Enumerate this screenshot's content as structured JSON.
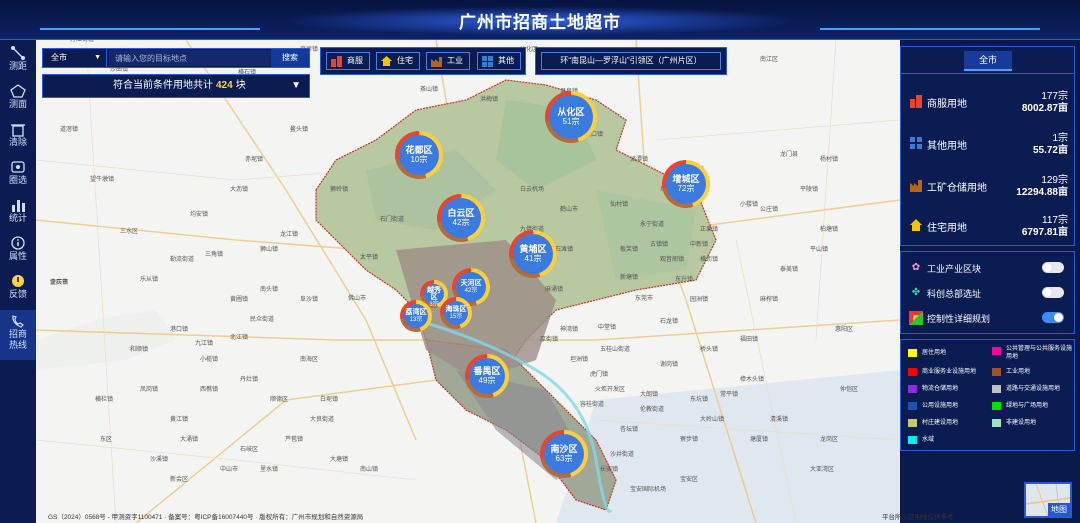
{
  "header": {
    "title": "广州市招商土地超市"
  },
  "sidebar": {
    "items": [
      {
        "label": "测距",
        "icon": "ruler-icon"
      },
      {
        "label": "测面",
        "icon": "polygon-icon"
      },
      {
        "label": "清除",
        "icon": "trash-icon"
      },
      {
        "label": "圈选",
        "icon": "lasso-icon"
      },
      {
        "label": "统计",
        "icon": "bar-chart-icon"
      },
      {
        "label": "属性",
        "icon": "info-icon"
      },
      {
        "label": "反馈",
        "icon": "feedback-icon"
      },
      {
        "label": "招商\n热线",
        "icon": "phone-icon"
      }
    ]
  },
  "search": {
    "city": "全市",
    "placeholder": "请输入您的目标地点",
    "button": "搜索"
  },
  "result": {
    "prefix": "符合当前条件用地共计",
    "count": "424",
    "suffix": "块"
  },
  "categories": [
    {
      "label": "商服",
      "icon": "shop-icon",
      "color": "#e8452e"
    },
    {
      "label": "住宅",
      "icon": "house-icon",
      "color": "#f5c400"
    },
    {
      "label": "工业",
      "icon": "factory-icon",
      "color": "#b5651d"
    },
    {
      "label": "其他",
      "icon": "grid-icon",
      "color": "#3a7bd5"
    }
  ],
  "ring_zone": {
    "label": "环“南昆山—罗浮山”引领区（广州片区）"
  },
  "stats_panel": {
    "tab": "全市",
    "items": [
      {
        "label": "商服用地",
        "count": "177宗",
        "area": "8002.87亩",
        "icon": "shop-icon",
        "color": "#e8452e"
      },
      {
        "label": "其他用地",
        "count": "1宗",
        "area": "55.72亩",
        "icon": "grid-icon",
        "color": "#3a7bd5"
      },
      {
        "label": "工矿仓储用地",
        "count": "129宗",
        "area": "12294.88亩",
        "icon": "factory-icon",
        "color": "#b5651d"
      },
      {
        "label": "住宅用地",
        "count": "117宗",
        "area": "6797.81亩",
        "icon": "house-icon",
        "color": "#f5c400"
      }
    ]
  },
  "layers": [
    {
      "label": "工业产业区块",
      "on": false,
      "icon": "industry-block-icon"
    },
    {
      "label": "科创总部选址",
      "on": false,
      "icon": "hq-site-icon"
    },
    {
      "label": "控制性详细规划",
      "on": true,
      "icon": "zoning-plan-icon"
    }
  ],
  "legend": [
    {
      "label": "居住用地",
      "color": "#ffff00"
    },
    {
      "label": "公共管理与公共服务设施用地",
      "color": "#ff00a0"
    },
    {
      "label": "商业服务业设施用地",
      "color": "#ff0000"
    },
    {
      "label": "工业用地",
      "color": "#a0522d"
    },
    {
      "label": "物流仓储用地",
      "color": "#8a2be2"
    },
    {
      "label": "道路与交通设施用地",
      "color": "#c0c0c0"
    },
    {
      "label": "公用设施用地",
      "color": "#1e50b4"
    },
    {
      "label": "绿地与广场用地",
      "color": "#00e000"
    },
    {
      "label": "村庄建设用地",
      "color": "#c8c864"
    },
    {
      "label": "非建设用地",
      "color": "#9fe2bf"
    },
    {
      "label": "水域",
      "color": "#00f0f0"
    }
  ],
  "districts": [
    {
      "name": "从化区",
      "count": "51宗"
    },
    {
      "name": "花都区",
      "count": "10宗"
    },
    {
      "name": "增城区",
      "count": "72宗"
    },
    {
      "name": "白云区",
      "count": "42宗"
    },
    {
      "name": "黄埔区",
      "count": "41宗"
    },
    {
      "name": "天河区",
      "count": "42宗"
    },
    {
      "name": "越秀区",
      "count": "3宗"
    },
    {
      "name": "荔湾区",
      "count": "13宗"
    },
    {
      "name": "海珠区",
      "count": "15宗"
    },
    {
      "name": "番禺区",
      "count": "49宗"
    },
    {
      "name": "南沙区",
      "count": "63宗"
    }
  ],
  "place_labels": [
    "肇庆市",
    "佛山市",
    "东莞市",
    "横石镇",
    "九江镇",
    "三水区",
    "北江镇",
    "石滩镇",
    "新塘镇",
    "中堂镇",
    "石龙镇",
    "麻涌镇",
    "塘厦镇",
    "清溪镇",
    "樟木头镇",
    "厚街镇",
    "虎门镇",
    "长安镇",
    "龙岗区",
    "惠阳区",
    "仲恺区",
    "宝安区",
    "南海区",
    "顺德区",
    "中山市",
    "沙井街道",
    "大良街道",
    "宝安国际机场",
    "大亚湾区",
    "新会区",
    "石岐区",
    "大涌镇",
    "从化区",
    "南江区",
    "狮岭镇",
    "太平镇",
    "温泉镇",
    "吕田镇",
    "鳌头镇",
    "赤坭镇",
    "良口镇",
    "花东镇",
    "派潭镇",
    "正果镇",
    "小楼镇",
    "增江街道",
    "仙村镇",
    "永宁街道",
    "荔城街道",
    "中新镇",
    "石门街道",
    "九佛街道",
    "龙门县",
    "平陵镇",
    "平山镇",
    "麻榨镇",
    "杨村镇",
    "柏塘镇",
    "泰美镇",
    "横沥镇",
    "福田镇",
    "公庄镇",
    "观音阁镇",
    "园洲镇",
    "桥头镇",
    "谢岗镇",
    "常平镇",
    "东坑镇",
    "大朗镇",
    "大岭山镇",
    "寮步镇",
    "黄江镇",
    "凤岗镇",
    "沙溪镇",
    "东区",
    "横栏镇",
    "小榄镇",
    "民众街道",
    "黄圃镇",
    "南头镇",
    "阜沙镇",
    "港口镇",
    "三角镇",
    "均安镇",
    "勒流街道",
    "乐从镇",
    "大沥镇",
    "狮山镇",
    "西樵镇",
    "丹灶镇",
    "白坭镇",
    "芦苞镇",
    "大塘镇",
    "南山镇",
    "里水镇",
    "和顺镇",
    "龙江镇",
    "杏坛镇",
    "伦教街道",
    "容桂街道",
    "五桂山街道",
    "火炬开发区",
    "坦洲镇",
    "神湾镇",
    "板芙镇",
    "古镇镇",
    "东升镇",
    "鹤山市",
    "白云机场",
    "石碣镇",
    "茶山镇",
    "洪梅镇",
    "望牛墩镇",
    "道滘镇",
    "沙田镇",
    "万江街道",
    "莞城街道",
    "高埗镇",
    "石排镇",
    "企石镇"
  ],
  "footer": {
    "left": "GS（2024）0568号 - 甲测资字1100471 · 备案号：粤ICP备16007440号 · 版权所有：广州市规划和自然资源局",
    "right": "平台所示范围线仅供参考"
  },
  "minimap": {
    "label": "地图"
  }
}
